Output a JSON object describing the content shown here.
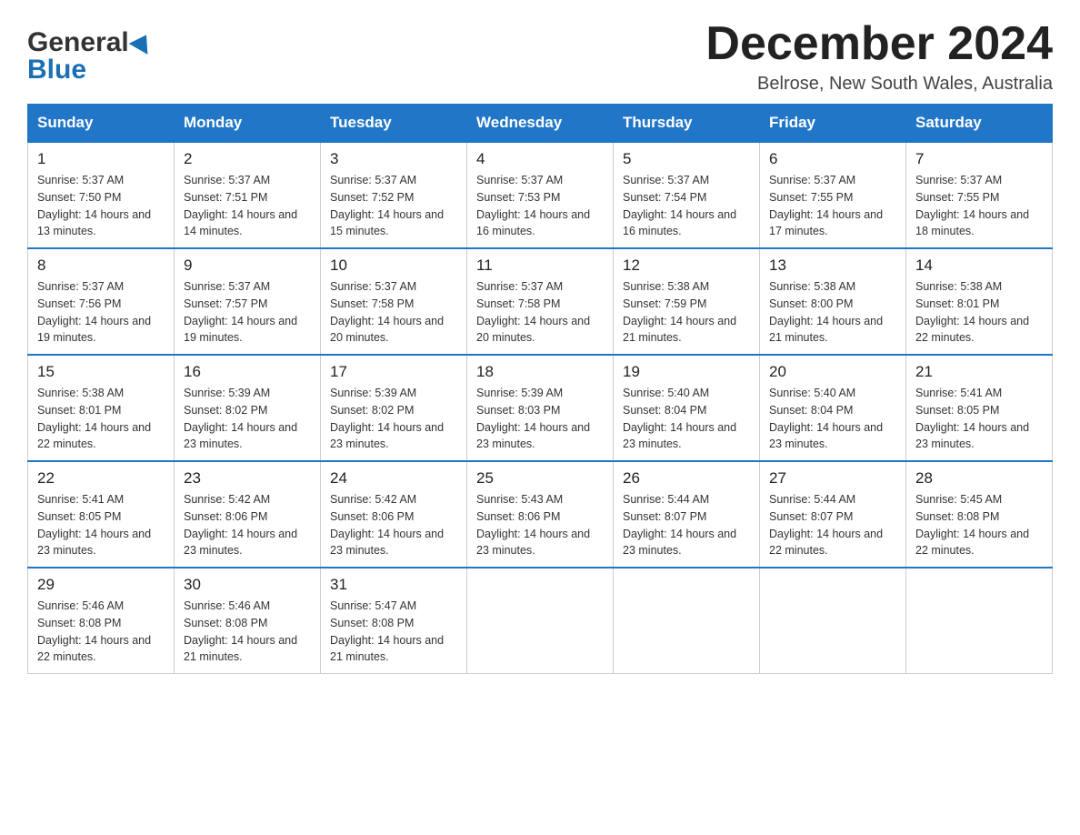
{
  "header": {
    "title": "December 2024",
    "location": "Belrose, New South Wales, Australia",
    "logo_general": "General",
    "logo_blue": "Blue"
  },
  "columns": [
    "Sunday",
    "Monday",
    "Tuesday",
    "Wednesday",
    "Thursday",
    "Friday",
    "Saturday"
  ],
  "weeks": [
    [
      {
        "day": "1",
        "sunrise": "5:37 AM",
        "sunset": "7:50 PM",
        "daylight": "14 hours and 13 minutes."
      },
      {
        "day": "2",
        "sunrise": "5:37 AM",
        "sunset": "7:51 PM",
        "daylight": "14 hours and 14 minutes."
      },
      {
        "day": "3",
        "sunrise": "5:37 AM",
        "sunset": "7:52 PM",
        "daylight": "14 hours and 15 minutes."
      },
      {
        "day": "4",
        "sunrise": "5:37 AM",
        "sunset": "7:53 PM",
        "daylight": "14 hours and 16 minutes."
      },
      {
        "day": "5",
        "sunrise": "5:37 AM",
        "sunset": "7:54 PM",
        "daylight": "14 hours and 16 minutes."
      },
      {
        "day": "6",
        "sunrise": "5:37 AM",
        "sunset": "7:55 PM",
        "daylight": "14 hours and 17 minutes."
      },
      {
        "day": "7",
        "sunrise": "5:37 AM",
        "sunset": "7:55 PM",
        "daylight": "14 hours and 18 minutes."
      }
    ],
    [
      {
        "day": "8",
        "sunrise": "5:37 AM",
        "sunset": "7:56 PM",
        "daylight": "14 hours and 19 minutes."
      },
      {
        "day": "9",
        "sunrise": "5:37 AM",
        "sunset": "7:57 PM",
        "daylight": "14 hours and 19 minutes."
      },
      {
        "day": "10",
        "sunrise": "5:37 AM",
        "sunset": "7:58 PM",
        "daylight": "14 hours and 20 minutes."
      },
      {
        "day": "11",
        "sunrise": "5:37 AM",
        "sunset": "7:58 PM",
        "daylight": "14 hours and 20 minutes."
      },
      {
        "day": "12",
        "sunrise": "5:38 AM",
        "sunset": "7:59 PM",
        "daylight": "14 hours and 21 minutes."
      },
      {
        "day": "13",
        "sunrise": "5:38 AM",
        "sunset": "8:00 PM",
        "daylight": "14 hours and 21 minutes."
      },
      {
        "day": "14",
        "sunrise": "5:38 AM",
        "sunset": "8:01 PM",
        "daylight": "14 hours and 22 minutes."
      }
    ],
    [
      {
        "day": "15",
        "sunrise": "5:38 AM",
        "sunset": "8:01 PM",
        "daylight": "14 hours and 22 minutes."
      },
      {
        "day": "16",
        "sunrise": "5:39 AM",
        "sunset": "8:02 PM",
        "daylight": "14 hours and 23 minutes."
      },
      {
        "day": "17",
        "sunrise": "5:39 AM",
        "sunset": "8:02 PM",
        "daylight": "14 hours and 23 minutes."
      },
      {
        "day": "18",
        "sunrise": "5:39 AM",
        "sunset": "8:03 PM",
        "daylight": "14 hours and 23 minutes."
      },
      {
        "day": "19",
        "sunrise": "5:40 AM",
        "sunset": "8:04 PM",
        "daylight": "14 hours and 23 minutes."
      },
      {
        "day": "20",
        "sunrise": "5:40 AM",
        "sunset": "8:04 PM",
        "daylight": "14 hours and 23 minutes."
      },
      {
        "day": "21",
        "sunrise": "5:41 AM",
        "sunset": "8:05 PM",
        "daylight": "14 hours and 23 minutes."
      }
    ],
    [
      {
        "day": "22",
        "sunrise": "5:41 AM",
        "sunset": "8:05 PM",
        "daylight": "14 hours and 23 minutes."
      },
      {
        "day": "23",
        "sunrise": "5:42 AM",
        "sunset": "8:06 PM",
        "daylight": "14 hours and 23 minutes."
      },
      {
        "day": "24",
        "sunrise": "5:42 AM",
        "sunset": "8:06 PM",
        "daylight": "14 hours and 23 minutes."
      },
      {
        "day": "25",
        "sunrise": "5:43 AM",
        "sunset": "8:06 PM",
        "daylight": "14 hours and 23 minutes."
      },
      {
        "day": "26",
        "sunrise": "5:44 AM",
        "sunset": "8:07 PM",
        "daylight": "14 hours and 23 minutes."
      },
      {
        "day": "27",
        "sunrise": "5:44 AM",
        "sunset": "8:07 PM",
        "daylight": "14 hours and 22 minutes."
      },
      {
        "day": "28",
        "sunrise": "5:45 AM",
        "sunset": "8:08 PM",
        "daylight": "14 hours and 22 minutes."
      }
    ],
    [
      {
        "day": "29",
        "sunrise": "5:46 AM",
        "sunset": "8:08 PM",
        "daylight": "14 hours and 22 minutes."
      },
      {
        "day": "30",
        "sunrise": "5:46 AM",
        "sunset": "8:08 PM",
        "daylight": "14 hours and 21 minutes."
      },
      {
        "day": "31",
        "sunrise": "5:47 AM",
        "sunset": "8:08 PM",
        "daylight": "14 hours and 21 minutes."
      },
      null,
      null,
      null,
      null
    ]
  ]
}
